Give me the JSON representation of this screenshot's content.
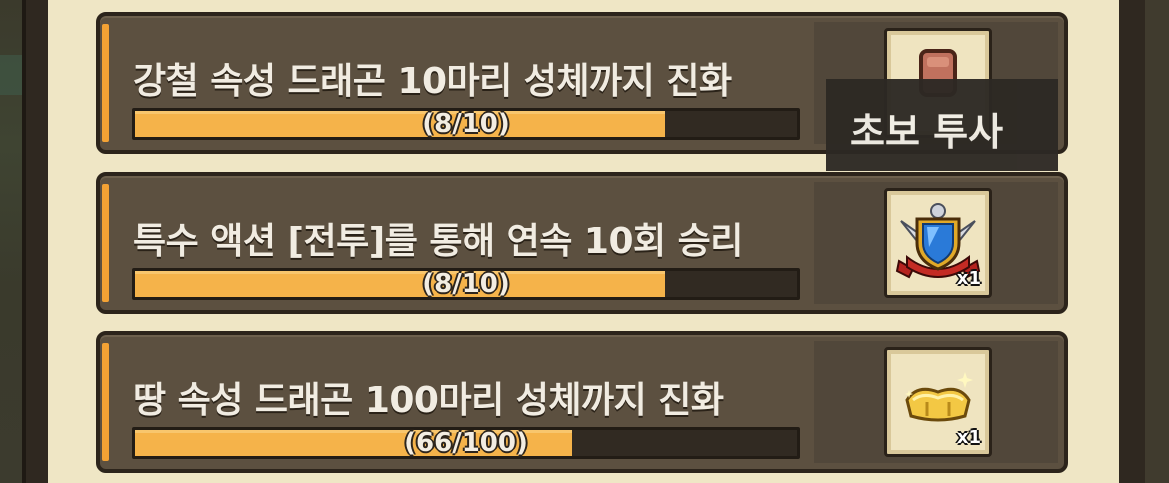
{
  "quests": [
    {
      "title": "강철 속성 드래곤 10마리 성체까지 진화",
      "progress_text": "(8/10)",
      "progress": 0.8,
      "reward_icon": "leather-scroll-icon",
      "reward_qty": ""
    },
    {
      "title": "특수 액션 [전투]를 통해 연속 10회 승리",
      "progress_text": "(8/10)",
      "progress": 0.8,
      "reward_icon": "shield-crest-icon",
      "reward_qty": "x1"
    },
    {
      "title": "땅 속성 드래곤 100마리 성체까지 진화",
      "progress_text": "(66/100)",
      "progress": 0.66,
      "reward_icon": "golden-cushion-icon",
      "reward_qty": "x1"
    }
  ],
  "tooltip": {
    "text": "초보 투사"
  },
  "colors": {
    "accent": "#f3a234",
    "bar_fill": "#f5b34a",
    "card_bg": "#5c5040",
    "parchment": "#efe6c5"
  }
}
